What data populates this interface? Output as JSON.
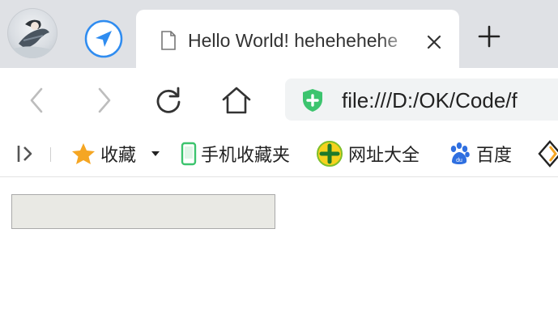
{
  "tab": {
    "title": "Hello World! hehehehehe",
    "close_glyph": "✕",
    "new_tab_glyph": "+"
  },
  "address": {
    "url": "file:///D:/OK/Code/f"
  },
  "bookmarks": {
    "items": [
      {
        "label": "收藏",
        "icon": "star-icon"
      },
      {
        "label": "手机收藏夹",
        "icon": "phone-icon"
      },
      {
        "label": "网址大全",
        "icon": "web-directory-icon"
      },
      {
        "label": "百度",
        "icon": "baidu-paw-icon"
      }
    ]
  },
  "colors": {
    "tabstrip": "#dfe1e5",
    "shield_green": "#3cc46e",
    "star": "#f5a623",
    "baidu_blue": "#2f6fe0",
    "nav_blue": "#2f8cf0"
  }
}
